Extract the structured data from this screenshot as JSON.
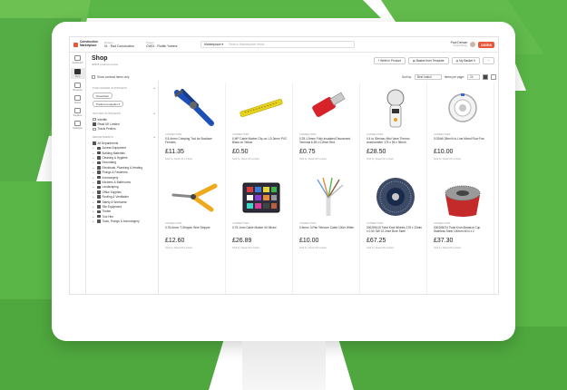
{
  "topbar": {
    "brand_line1": "Construction",
    "brand_line2": "Marketplace",
    "selector1_label": "Division",
    "selector1_value": "01 · Rad Construction",
    "selector2_label": "Project",
    "selector2_value": "CW01 · Rodtin Yorkers",
    "marketplace_label": "Marketplace",
    "search_placeholder": "Search Marketplace items...",
    "user_name": "Paul Deman",
    "user_role": "Project Buyer",
    "coins_label": "coins"
  },
  "rail": [
    {
      "label": "Dashboard"
    },
    {
      "label": "Shop"
    },
    {
      "label": "Requests"
    },
    {
      "label": "Orders"
    },
    {
      "label": "Suppliers"
    },
    {
      "label": "Catalogue"
    }
  ],
  "header": {
    "title": "Shop",
    "count": "40978 products found",
    "btn_wishlist": "Write in Product",
    "btn_template": "Basket from Template",
    "btn_basket": "My Basket",
    "btn_basket_count": "0",
    "btn_more": "···"
  },
  "subbar": {
    "contract_only": "Show contract items only",
    "sort_label": "Sort by:",
    "sort_value": "Best match",
    "per_page_label": "Items per page:",
    "per_page_value": "24"
  },
  "filters": {
    "purchased_title": "PURCHASED SUPPLIERS",
    "purchased_tags": [
      "Greenham",
      "Preferred supplier 2"
    ],
    "invited_title": "INVITED SUPPLIERS",
    "invited": [
      "Intertile",
      "Read UK Limited",
      "Travis Perkins"
    ],
    "departments_title": "DEPARTMENTS",
    "departments": [
      "All Departments",
      "Access Equipment",
      "Building Materials",
      "Cleaning & Hygiene",
      "Decorating",
      "Electricals, Plumbing & Heating",
      "Fixings & Fasteners",
      "Ironmongery",
      "Kitchens & Bathrooms",
      "Landscaping",
      "Office Supplies",
      "Roofing & Ventilation",
      "Safety & Workwear",
      "Site Equipment",
      "Timber",
      "Tool Hire",
      "Tools, Fixings & Ironmongery"
    ]
  },
  "products": [
    {
      "code": "CONNECTORS",
      "name": "0.5-4mm² Crimping Tool for Bootlace Ferrules",
      "price": "£11.35",
      "sold": "Sold by: Read UK Limited"
    },
    {
      "code": "CONNECTORS",
      "name": "0 MP Cable Marker Clip-on 1.5-3mm² PVC Black on Yellow",
      "price": "£0.50",
      "sold": "Sold by: Read UK Limited"
    },
    {
      "code": "CONNECTORS",
      "name": "0.25-1.5mm² Fully Insulated Disconnect Terminal 6.35 x 0.8mm Red",
      "price": "£0.75",
      "sold": "Sold by: Read UK Limited"
    },
    {
      "code": "CONNECTORS",
      "name": "0.4 to 30m/sec Mini Vane Thermo Anemometer 175 x 55 x 36mm",
      "price": "£28.50",
      "sold": "Sold by: Read UK Limited"
    },
    {
      "code": "CONNECTORS",
      "name": "0.02kW 28m³/h In-Line Mixed Flow Fan",
      "price": "£10.00",
      "sold": "Sold by: Read UK Limited"
    },
    {
      "code": "CONNECTORS",
      "name": "0.75-6mm² T-Stripper Wire Stripper",
      "price": "£12.60",
      "sold": "Sold by: Read UK Limited"
    },
    {
      "code": "CONNECTORS",
      "name": "0.75-1mm Cable Marker Kit Mixed",
      "price": "£26.89",
      "sold": "Sold by: Read UK Limited"
    },
    {
      "code": "CONNECTORS",
      "name": "0.5mm² 3-Pair Telecom Cable 100m White",
      "price": "£10.00",
      "sold": "Sold by: Read UK Limited"
    },
    {
      "code": "CONNECTORS",
      "name": "000265115 Twist Knot Wheels 178 x 13mm x 0.50 SW 22.2mm Bore Steel",
      "price": "£67.25",
      "sold": "Sold by: Read UK Limited"
    },
    {
      "code": "CONNECTORS",
      "name": "000265074 Twist Knot Abrasive Cup Stainless Steel 100mm M14 x 2",
      "price": "£37.30",
      "sold": "Sold by: Read UK Limited"
    }
  ],
  "colors": {
    "brand_green": "#5ab647",
    "brand_orange": "#e8583a"
  }
}
